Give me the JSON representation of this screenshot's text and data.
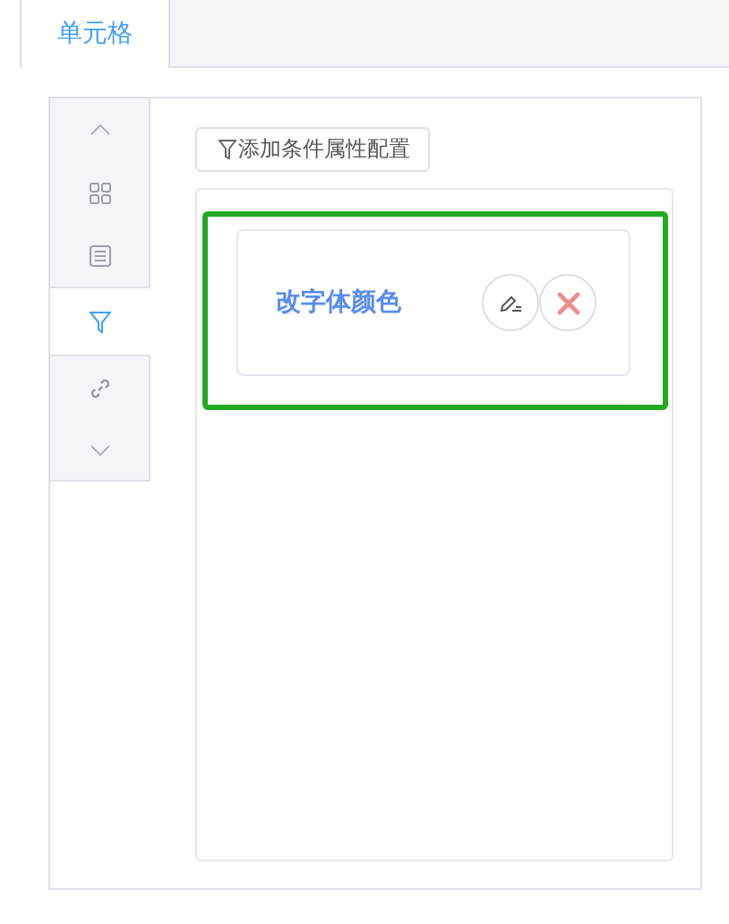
{
  "tabs": [
    {
      "label": "单元格",
      "selected": true
    }
  ],
  "side_nav": [
    {
      "kind": "up"
    },
    {
      "kind": "grid",
      "selected": false
    },
    {
      "kind": "list",
      "selected": false
    },
    {
      "kind": "filter",
      "selected": true
    },
    {
      "kind": "link",
      "selected": false
    },
    {
      "kind": "down"
    }
  ],
  "add_button": {
    "label": "添加条件属性配置"
  },
  "rules": [
    {
      "name": "改字体颜色",
      "selected": true
    }
  ]
}
